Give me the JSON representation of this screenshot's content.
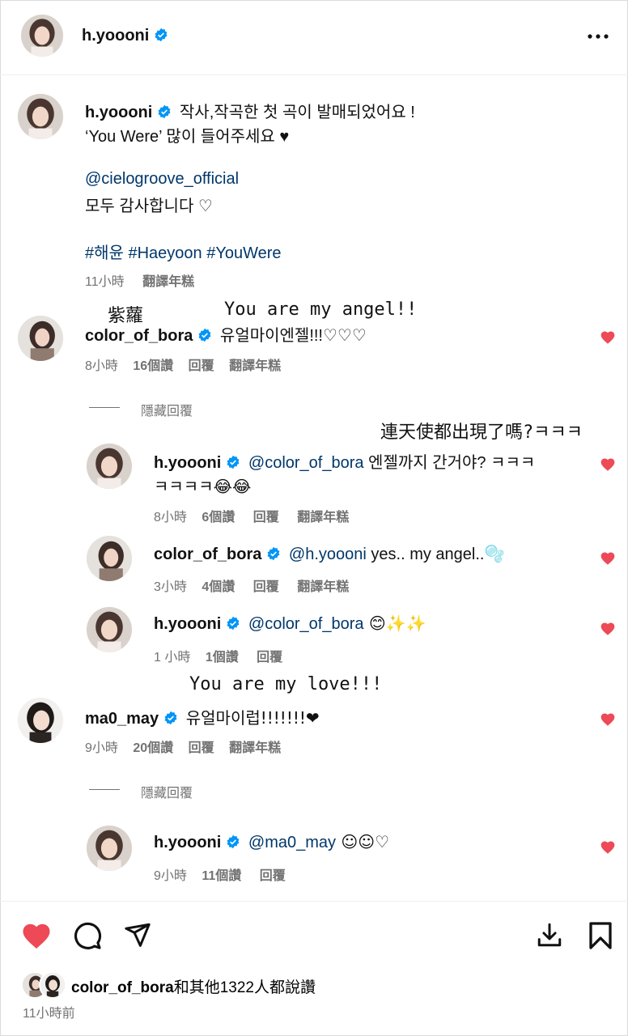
{
  "header": {
    "username": "h.yoooni",
    "more_icon": "more-horizontal-icon"
  },
  "caption": {
    "username": "h.yoooni",
    "line1": "작사,작곡한 첫 곡이 발매되었어요 !",
    "line2": "‘You Were’ 많이 들어주세요 ♥",
    "mention": "@cielogroove_official",
    "line3": "모두 감사합니다 ♡",
    "hashtags": "#해윤 #Haeyoon #YouWere",
    "time": "11小時",
    "translate": "翻譯年糕"
  },
  "annotations": {
    "bora_name": "紫蘿",
    "bora_translation": "You are my angel!!",
    "reply1_translation": "連天使都出現了嗎?ㅋㅋㅋ",
    "may_translation": "You are my love!!!"
  },
  "comments": [
    {
      "username": "color_of_bora",
      "text": "유얼마이엔젤!!!♡♡♡",
      "time": "8小時",
      "likes": "16個讚",
      "reply": "回覆",
      "translate": "翻譯年糕",
      "hide": "隱藏回覆",
      "replies": [
        {
          "username": "h.yoooni",
          "mention": "@color_of_bora",
          "text": " 엔젤까지 간거야? ㅋㅋㅋ",
          "text2": "ㅋㅋㅋㅋ😂😂",
          "time": "8小時",
          "likes": "6個讚",
          "reply": "回覆",
          "translate": "翻譯年糕"
        },
        {
          "username": "color_of_bora",
          "mention": "@h.yoooni",
          "text": " yes.. my angel..🫧",
          "time": "3小時",
          "likes": "4個讚",
          "reply": "回覆",
          "translate": "翻譯年糕"
        },
        {
          "username": "h.yoooni",
          "mention": "@color_of_bora",
          "text": " 😊✨✨",
          "time": "1 小時",
          "likes": "1個讚",
          "reply": "回覆"
        }
      ]
    },
    {
      "username": "ma0_may",
      "text": "유얼마이럽!!!!!!!❤",
      "time": "9小時",
      "likes": "20個讚",
      "reply": "回覆",
      "translate": "翻譯年糕",
      "hide": "隱藏回覆",
      "replies": [
        {
          "username": "h.yoooni",
          "mention": "@ma0_may",
          "text": " ☺☺♡",
          "time": "9小時",
          "likes": "11個讚",
          "reply": "回覆"
        }
      ]
    }
  ],
  "footer": {
    "liked_by_user": "color_of_bora",
    "liked_by_rest": "和其他1322人都說讚",
    "time": "11小時前"
  },
  "colors": {
    "like_red": "#ed4956",
    "verified_blue": "#0095f6",
    "link": "#00376b",
    "meta_gray": "#737373"
  }
}
